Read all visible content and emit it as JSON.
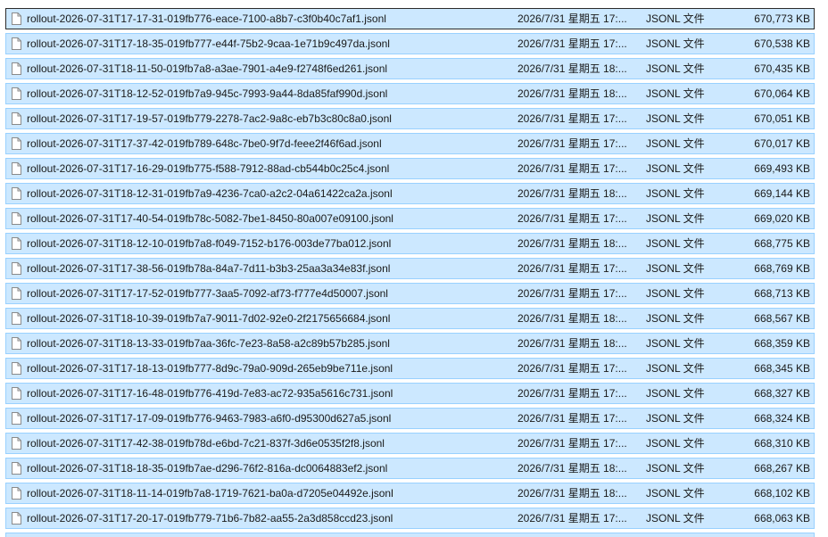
{
  "files": [
    {
      "name": "rollout-2026-07-31T17-17-31-019fb776-eace-7100-a8b7-c3f0b40c7af1.jsonl",
      "date": "2026/7/31 星期五 17:...",
      "type": "JSONL 文件",
      "size": "670,773 KB"
    },
    {
      "name": "rollout-2026-07-31T17-18-35-019fb777-e44f-75b2-9caa-1e71b9c497da.jsonl",
      "date": "2026/7/31 星期五 17:...",
      "type": "JSONL 文件",
      "size": "670,538 KB"
    },
    {
      "name": "rollout-2026-07-31T18-11-50-019fb7a8-a3ae-7901-a4e9-f2748f6ed261.jsonl",
      "date": "2026/7/31 星期五 18:...",
      "type": "JSONL 文件",
      "size": "670,435 KB"
    },
    {
      "name": "rollout-2026-07-31T18-12-52-019fb7a9-945c-7993-9a44-8da85faf990d.jsonl",
      "date": "2026/7/31 星期五 18:...",
      "type": "JSONL 文件",
      "size": "670,064 KB"
    },
    {
      "name": "rollout-2026-07-31T17-19-57-019fb779-2278-7ac2-9a8c-eb7b3c80c8a0.jsonl",
      "date": "2026/7/31 星期五 17:...",
      "type": "JSONL 文件",
      "size": "670,051 KB"
    },
    {
      "name": "rollout-2026-07-31T17-37-42-019fb789-648c-7be0-9f7d-feee2f46f6ad.jsonl",
      "date": "2026/7/31 星期五 17:...",
      "type": "JSONL 文件",
      "size": "670,017 KB"
    },
    {
      "name": "rollout-2026-07-31T17-16-29-019fb775-f588-7912-88ad-cb544b0c25c4.jsonl",
      "date": "2026/7/31 星期五 17:...",
      "type": "JSONL 文件",
      "size": "669,493 KB"
    },
    {
      "name": "rollout-2026-07-31T18-12-31-019fb7a9-4236-7ca0-a2c2-04a61422ca2a.jsonl",
      "date": "2026/7/31 星期五 18:...",
      "type": "JSONL 文件",
      "size": "669,144 KB"
    },
    {
      "name": "rollout-2026-07-31T17-40-54-019fb78c-5082-7be1-8450-80a007e09100.jsonl",
      "date": "2026/7/31 星期五 17:...",
      "type": "JSONL 文件",
      "size": "669,020 KB"
    },
    {
      "name": "rollout-2026-07-31T18-12-10-019fb7a8-f049-7152-b176-003de77ba012.jsonl",
      "date": "2026/7/31 星期五 18:...",
      "type": "JSONL 文件",
      "size": "668,775 KB"
    },
    {
      "name": "rollout-2026-07-31T17-38-56-019fb78a-84a7-7d11-b3b3-25aa3a34e83f.jsonl",
      "date": "2026/7/31 星期五 17:...",
      "type": "JSONL 文件",
      "size": "668,769 KB"
    },
    {
      "name": "rollout-2026-07-31T17-17-52-019fb777-3aa5-7092-af73-f777e4d50007.jsonl",
      "date": "2026/7/31 星期五 17:...",
      "type": "JSONL 文件",
      "size": "668,713 KB"
    },
    {
      "name": "rollout-2026-07-31T18-10-39-019fb7a7-9011-7d02-92e0-2f2175656684.jsonl",
      "date": "2026/7/31 星期五 18:...",
      "type": "JSONL 文件",
      "size": "668,567 KB"
    },
    {
      "name": "rollout-2026-07-31T18-13-33-019fb7aa-36fc-7e23-8a58-a2c89b57b285.jsonl",
      "date": "2026/7/31 星期五 18:...",
      "type": "JSONL 文件",
      "size": "668,359 KB"
    },
    {
      "name": "rollout-2026-07-31T17-18-13-019fb777-8d9c-79a0-909d-265eb9be711e.jsonl",
      "date": "2026/7/31 星期五 17:...",
      "type": "JSONL 文件",
      "size": "668,345 KB"
    },
    {
      "name": "rollout-2026-07-31T17-16-48-019fb776-419d-7e83-ac72-935a5616c731.jsonl",
      "date": "2026/7/31 星期五 17:...",
      "type": "JSONL 文件",
      "size": "668,327 KB"
    },
    {
      "name": "rollout-2026-07-31T17-17-09-019fb776-9463-7983-a6f0-d95300d627a5.jsonl",
      "date": "2026/7/31 星期五 17:...",
      "type": "JSONL 文件",
      "size": "668,324 KB"
    },
    {
      "name": "rollout-2026-07-31T17-42-38-019fb78d-e6bd-7c21-837f-3d6e0535f2f8.jsonl",
      "date": "2026/7/31 星期五 17:...",
      "type": "JSONL 文件",
      "size": "668,310 KB"
    },
    {
      "name": "rollout-2026-07-31T18-18-35-019fb7ae-d296-76f2-816a-dc0064883ef2.jsonl",
      "date": "2026/7/31 星期五 18:...",
      "type": "JSONL 文件",
      "size": "668,267 KB"
    },
    {
      "name": "rollout-2026-07-31T18-11-14-019fb7a8-1719-7621-ba0a-d7205e04492e.jsonl",
      "date": "2026/7/31 星期五 18:...",
      "type": "JSONL 文件",
      "size": "668,102 KB"
    },
    {
      "name": "rollout-2026-07-31T17-20-17-019fb779-71b6-7b82-aa55-2a3d858ccd23.jsonl",
      "date": "2026/7/31 星期五 17:...",
      "type": "JSONL 文件",
      "size": "668,063 KB"
    }
  ],
  "icons": {
    "file": "file-icon"
  },
  "colors": {
    "selection_fill": "#cce8ff",
    "selection_border": "#99d1ff",
    "focus_border": "#2b2b2b"
  }
}
